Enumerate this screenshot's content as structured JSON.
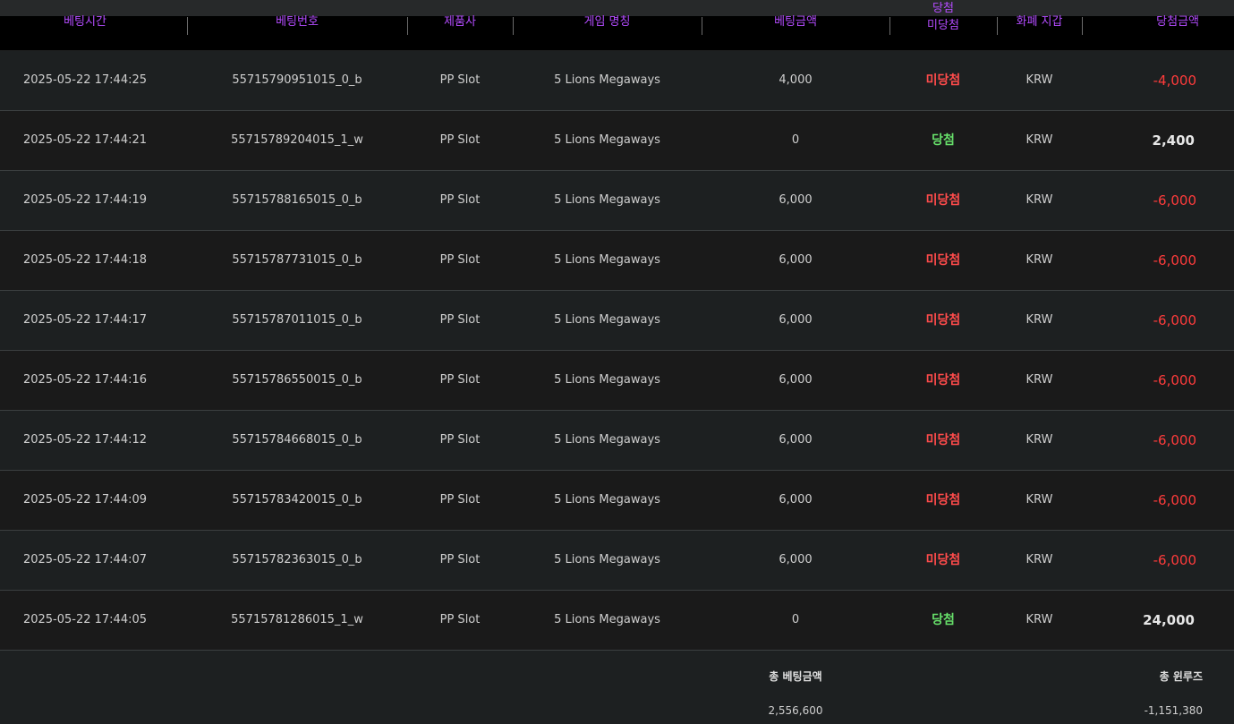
{
  "headers": {
    "time": "베팅시간",
    "bet_no": "베팅번호",
    "vendor": "제품사",
    "game": "게임 명칭",
    "bet_amount": "베팅금액",
    "result_top": "당첨",
    "result": "미당첨",
    "wallet": "화폐 지갑",
    "win_amount": "당첨금액"
  },
  "rows": [
    {
      "time": "2025-05-22 17:44:25",
      "bet_no": "55715790951015_0_b",
      "vendor": "PP Slot",
      "game": "5 Lions Megaways",
      "bet_amount": "4,000",
      "result": "미당첨",
      "result_type": "lose",
      "wallet": "KRW",
      "win_amount": "-4,000",
      "amount_type": "neg"
    },
    {
      "time": "2025-05-22 17:44:21",
      "bet_no": "55715789204015_1_w",
      "vendor": "PP Slot",
      "game": "5 Lions Megaways",
      "bet_amount": "0",
      "result": "당첨",
      "result_type": "win",
      "wallet": "KRW",
      "win_amount": "2,400",
      "amount_type": "pos"
    },
    {
      "time": "2025-05-22 17:44:19",
      "bet_no": "55715788165015_0_b",
      "vendor": "PP Slot",
      "game": "5 Lions Megaways",
      "bet_amount": "6,000",
      "result": "미당첨",
      "result_type": "lose",
      "wallet": "KRW",
      "win_amount": "-6,000",
      "amount_type": "neg"
    },
    {
      "time": "2025-05-22 17:44:18",
      "bet_no": "55715787731015_0_b",
      "vendor": "PP Slot",
      "game": "5 Lions Megaways",
      "bet_amount": "6,000",
      "result": "미당첨",
      "result_type": "lose",
      "wallet": "KRW",
      "win_amount": "-6,000",
      "amount_type": "neg"
    },
    {
      "time": "2025-05-22 17:44:17",
      "bet_no": "55715787011015_0_b",
      "vendor": "PP Slot",
      "game": "5 Lions Megaways",
      "bet_amount": "6,000",
      "result": "미당첨",
      "result_type": "lose",
      "wallet": "KRW",
      "win_amount": "-6,000",
      "amount_type": "neg"
    },
    {
      "time": "2025-05-22 17:44:16",
      "bet_no": "55715786550015_0_b",
      "vendor": "PP Slot",
      "game": "5 Lions Megaways",
      "bet_amount": "6,000",
      "result": "미당첨",
      "result_type": "lose",
      "wallet": "KRW",
      "win_amount": "-6,000",
      "amount_type": "neg"
    },
    {
      "time": "2025-05-22 17:44:12",
      "bet_no": "55715784668015_0_b",
      "vendor": "PP Slot",
      "game": "5 Lions Megaways",
      "bet_amount": "6,000",
      "result": "미당첨",
      "result_type": "lose",
      "wallet": "KRW",
      "win_amount": "-6,000",
      "amount_type": "neg"
    },
    {
      "time": "2025-05-22 17:44:09",
      "bet_no": "55715783420015_0_b",
      "vendor": "PP Slot",
      "game": "5 Lions Megaways",
      "bet_amount": "6,000",
      "result": "미당첨",
      "result_type": "lose",
      "wallet": "KRW",
      "win_amount": "-6,000",
      "amount_type": "neg"
    },
    {
      "time": "2025-05-22 17:44:07",
      "bet_no": "55715782363015_0_b",
      "vendor": "PP Slot",
      "game": "5 Lions Megaways",
      "bet_amount": "6,000",
      "result": "미당첨",
      "result_type": "lose",
      "wallet": "KRW",
      "win_amount": "-6,000",
      "amount_type": "neg"
    },
    {
      "time": "2025-05-22 17:44:05",
      "bet_no": "55715781286015_1_w",
      "vendor": "PP Slot",
      "game": "5 Lions Megaways",
      "bet_amount": "0",
      "result": "당첨",
      "result_type": "win",
      "wallet": "KRW",
      "win_amount": "24,000",
      "amount_type": "pos"
    }
  ],
  "totals": {
    "bet_label": "총 베팅금액",
    "bet_value": "2,556,600",
    "winloss_label": "총 윈루즈",
    "winloss_value": "-1,151,380"
  },
  "colors": {
    "header_text": "#b44cff",
    "lose": "#ff4b4b",
    "win": "#67e06a",
    "negative_amount": "#ff3b3b"
  }
}
